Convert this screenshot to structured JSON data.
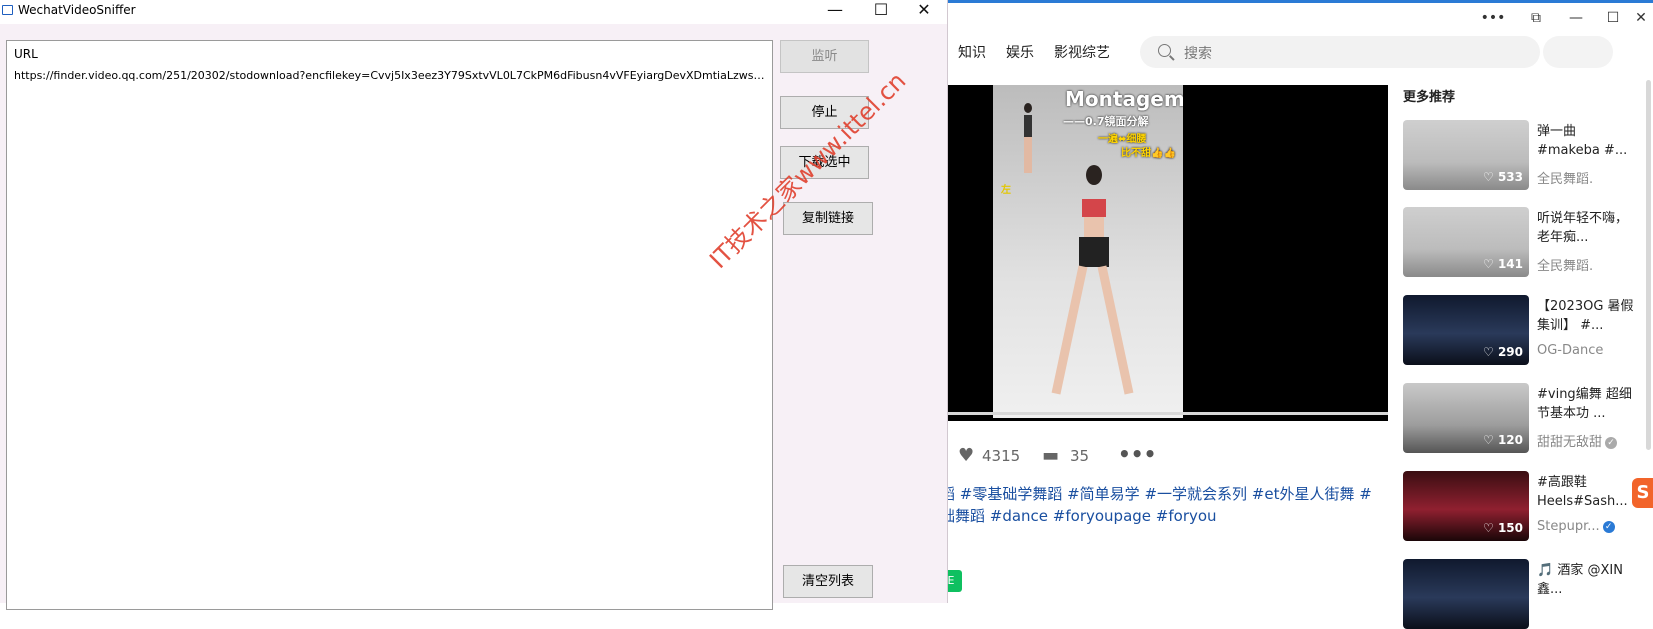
{
  "background_window": {
    "title_buttons": [
      "•••",
      "⧉",
      "—",
      "☐",
      "✕"
    ],
    "nav": [
      "知识",
      "娱乐",
      "影视综艺"
    ],
    "search": {
      "placeholder": "搜索"
    },
    "player": {
      "overlay_title": "Montagem",
      "overlay_sub": "——0.7镜面分解",
      "overlay_tag1": "一遍⬌细腰",
      "overlay_tag2": "比不甜👍👍",
      "overlay_tag3": "左"
    },
    "stats": {
      "likes": "4315",
      "comments": "35"
    },
    "tags_line1": "蹈 #零基础学舞蹈 #简单易学 #一学就会系列 #et外星人街舞 #",
    "tags_line2": "础舞蹈 #dance #foryoupage #foryou",
    "green_badge": "E",
    "recommendations_title": "更多推荐",
    "recommendations": [
      {
        "text": "弹一曲 #makeba #...",
        "author": "全民舞蹈.",
        "likes": "♡ 533",
        "thumb": ""
      },
      {
        "text": "听说年轻不嗨，老年痴...",
        "author": "全民舞蹈.",
        "likes": "♡ 141",
        "thumb": ""
      },
      {
        "text": "【2023OG 暑假集训】 #...",
        "author": "OG-Dance",
        "likes": "♡ 290",
        "thumb": "dark"
      },
      {
        "text": "#ving编舞 超细节基本功 ...",
        "author": "甜甜无敌甜",
        "likes": "♡ 120",
        "thumb": "gray"
      },
      {
        "text": "#高跟鞋 Heels#Sash...",
        "author": "Stepupr...",
        "likes": "♡ 150",
        "thumb": "red"
      },
      {
        "text": "🎵 酒家 @XIN鑫...",
        "author": "",
        "likes": "",
        "thumb": "dark"
      }
    ],
    "side_logo": "S"
  },
  "app": {
    "title": "WechatVideoSniffer",
    "window_buttons": {
      "minimize": "—",
      "maximize": "☐",
      "close": "✕"
    },
    "list": {
      "header": "URL",
      "rows": [
        "https://finder.video.qq.com/251/20302/stodownload?encfilekey=Cvvj5Ix3eez3Y79SxtvVL0L7CkPM6dFibusn4vVFEyiargDevXDmtiaLzwsNdfZd1..."
      ]
    },
    "buttons": {
      "listen": "监听",
      "stop": "停止",
      "download_selected": "下载选中",
      "copy_link": "复制链接",
      "clear_list": "清空列表"
    }
  },
  "watermark": "IT技术之家www.ittel.cn"
}
